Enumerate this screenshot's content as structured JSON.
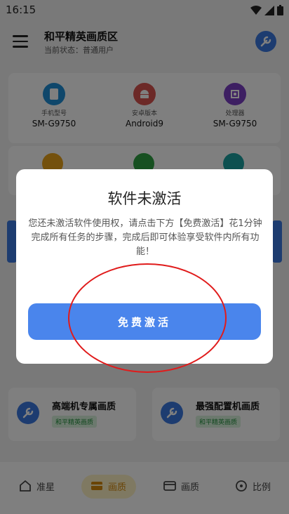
{
  "status_bar": {
    "time": "16:15"
  },
  "header": {
    "title": "和平精英画质区",
    "subtitle": "当前状态：普通用户"
  },
  "device_info": [
    {
      "label": "手机型号",
      "value": "SM-G9750",
      "icon": "phone-icon",
      "color": "#1f8fd6"
    },
    {
      "label": "安卓版本",
      "value": "Android9",
      "icon": "android-icon",
      "color": "#d9534f"
    },
    {
      "label": "处理器",
      "value": "SM-G9750",
      "icon": "cpu-icon",
      "color": "#7b3fc4"
    }
  ],
  "presets": [
    {
      "title": "高端机专属画质",
      "tag": "和平精英画质"
    },
    {
      "title": "最强配置机画质",
      "tag": "和平精英画质"
    }
  ],
  "bottom_nav": [
    {
      "label": "准星",
      "icon": "home-icon",
      "active": false
    },
    {
      "label": "画质",
      "icon": "quality-icon",
      "active": true
    },
    {
      "label": "画质",
      "icon": "screen-icon",
      "active": false
    },
    {
      "label": "比例",
      "icon": "ratio-icon",
      "active": false
    }
  ],
  "dialog": {
    "title": "软件未激活",
    "message": "您还未激活软件使用权，请点击下方【免费激活】花1分钟完成所有任务的步骤，完成后即可体验享受软件内所有功能！",
    "button_label": "免费激活"
  },
  "colors": {
    "accent": "#4a85ec",
    "annotation": "#e01b1b",
    "nav_active": "#d4880a"
  }
}
